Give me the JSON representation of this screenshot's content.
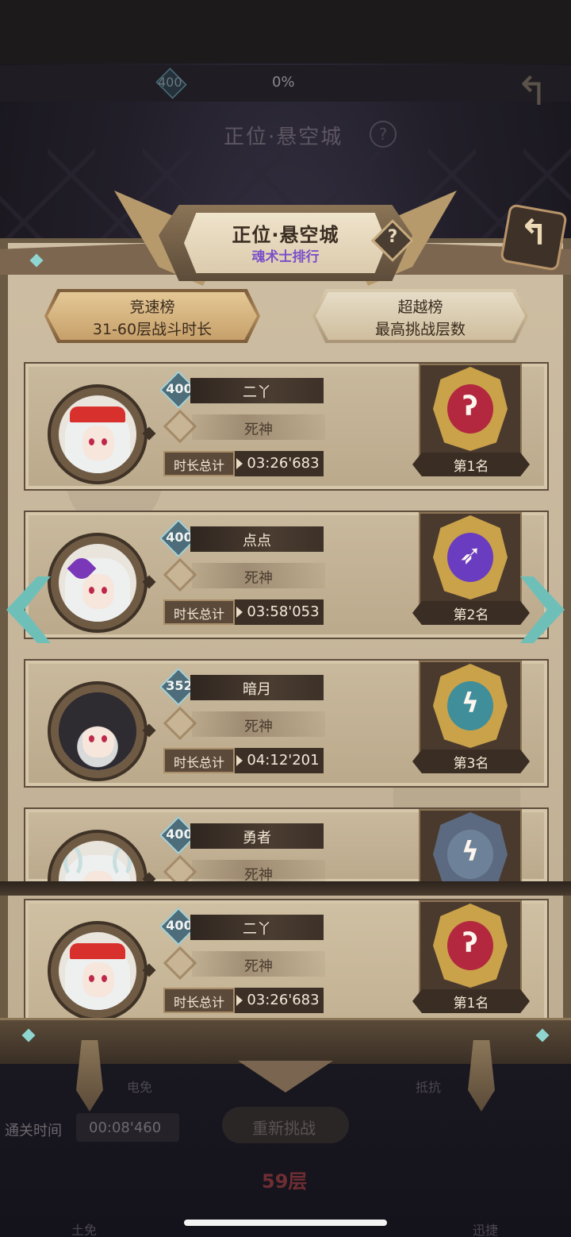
{
  "background": {
    "level": "400",
    "progress": "0%",
    "stage_title": "正位·悬空城",
    "help_glyph": "?",
    "skill_left": "电免",
    "skill_right": "抵抗",
    "clear_time_label": "通关时间",
    "clear_time_value": "00:08'460",
    "retry_label": "重新挑战",
    "floor_label": "59层",
    "bottom_left_label": "土免",
    "bottom_right_label": "迅捷"
  },
  "header": {
    "title": "正位·悬空城",
    "subtitle": "魂术士排行",
    "help_glyph": "?",
    "back_glyph": "↰"
  },
  "tabs": [
    {
      "title": "竞速榜",
      "subtitle": "31-60层战斗时长",
      "active": true
    },
    {
      "title": "超越榜",
      "subtitle": "最高挑战层数",
      "active": false
    }
  ],
  "time_label": "时长总计",
  "ranks": [
    {
      "level": "400",
      "name": "二丫",
      "class": "死神",
      "time": "03:26'683",
      "rank": "第1名",
      "medal_color": "#b3283f",
      "medal_ring": "#c9a24a"
    },
    {
      "level": "400",
      "name": "点点",
      "class": "死神",
      "time": "03:58'053",
      "rank": "第2名",
      "medal_color": "#6a3cc0",
      "medal_ring": "#c9a24a"
    },
    {
      "level": "352",
      "name": "暗月",
      "class": "死神",
      "time": "04:12'201",
      "rank": "第3名",
      "medal_color": "#3f8e9a",
      "medal_ring": "#c9a24a"
    },
    {
      "level": "400",
      "name": "勇者",
      "class": "死神",
      "medal_color": "#6d8298",
      "medal_ring": "#5b6a80"
    }
  ],
  "my_rank": {
    "level": "400",
    "name": "二丫",
    "class": "死神",
    "time": "03:26'683",
    "rank": "第1名",
    "medal_color": "#b3283f",
    "medal_ring": "#c9a24a"
  },
  "colors": {
    "accent_purple": "#7b50c9",
    "arrow_teal": "#6fbfb9",
    "panel_parchment": "#c7b69a"
  }
}
